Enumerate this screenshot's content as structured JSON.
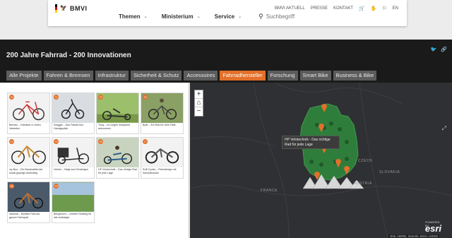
{
  "site": {
    "logo_text": "BMVI",
    "top_links": [
      "BMVI AKTUELL",
      "PRESSE",
      "KONTAKT"
    ],
    "lang": "EN",
    "nav": [
      "Themen",
      "Ministerium",
      "Service"
    ],
    "search_placeholder": "Suchbegriff"
  },
  "story": {
    "title": "200 Jahre Fahrrad - 200 Innovationen",
    "tabs": [
      "Alle Projekte",
      "Fahren & Bremsen",
      "Infrastruktur",
      "Sicherheit & Schutz",
      "Accessoires",
      "Fahrradhersteller",
      "Forschung",
      "Smart Bike",
      "Business & Bike"
    ],
    "active_tab": "Fahrradhersteller"
  },
  "gallery": {
    "items": [
      {
        "badge": "70",
        "caption": "Bemelo – Falträder in vielen Varianten"
      },
      {
        "badge": "71",
        "caption": "Kwiggle – Das Faltrad fürs Handgepäck"
      },
      {
        "badge": "72",
        "caption": "Tiocy – Im Liegen entspannt ankommen"
      },
      {
        "badge": "73",
        "caption": "Boar – Ein Rad für viele Fälle"
      },
      {
        "badge": "74",
        "caption": "my Boo – Ein Bambusfahrrad sozial geprägt nachhaltig"
      },
      {
        "badge": "75",
        "caption": "Velotm – Neigt zum Einsteigen"
      },
      {
        "badge": "76",
        "caption": "HP Velotechnik – Das richtige Rad für jede Lage"
      },
      {
        "badge": "77",
        "caption": "Ruff Cycles – Retrodesign mit Zukunftsmotor"
      },
      {
        "badge": "78",
        "caption": "hallorad – Mobiles Fahrrad, ganzer Fahrspaß"
      },
      {
        "badge": "79",
        "caption": "Bergamont – Leichter Einstieg für alle Aufsteiger"
      }
    ]
  },
  "map": {
    "zoom_in": "+",
    "zoom_out": "−",
    "home_icon": "home-icon",
    "tooltip": "HP Velotechnik - Das richtige Rad für jede Lage",
    "labels": [
      "CZECH",
      "FRANCE",
      "AUSTRIA",
      "SLOVAKIA"
    ],
    "attribution": "Esri, HERE, Garmin, NGA, USGS",
    "esri_powered": "POWERED BY",
    "esri_logo": "esri",
    "accent_color": "#e3702a",
    "germany_color": "#2f7d3b"
  }
}
